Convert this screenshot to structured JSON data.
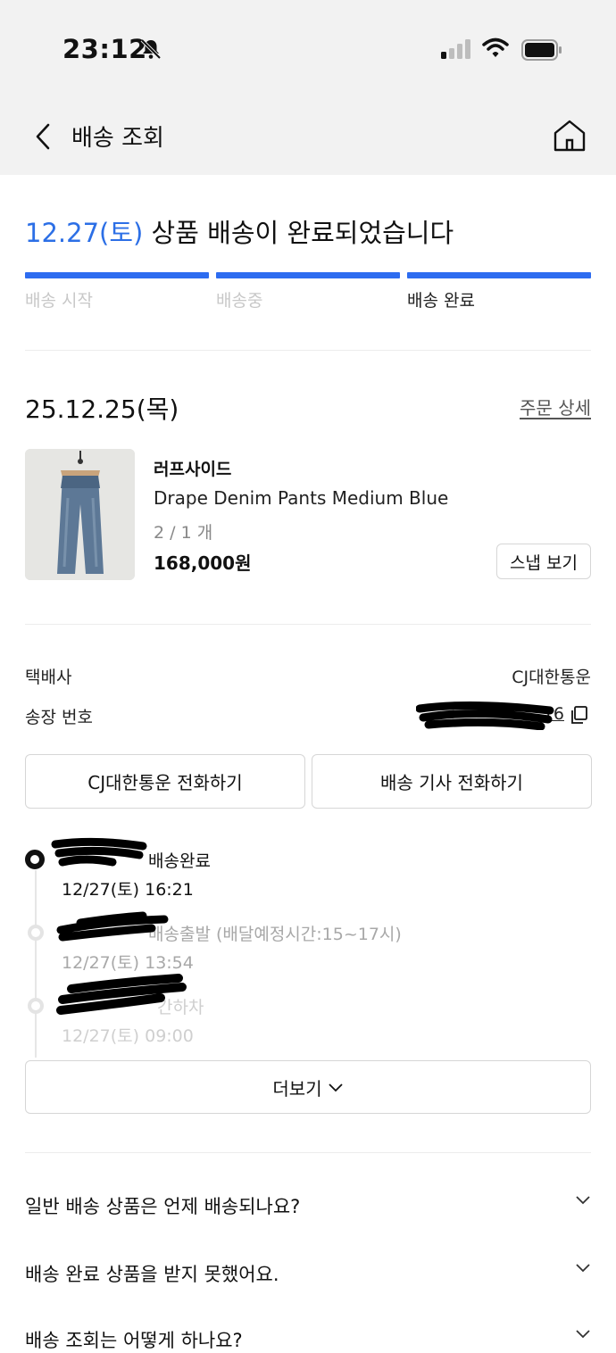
{
  "status_bar": {
    "time": "23:12"
  },
  "header": {
    "title": "배송 조회"
  },
  "headline": {
    "date": "12.27(토)",
    "text": " 상품 배송이 완료되었습니다"
  },
  "progress": {
    "steps": [
      {
        "label": "배송 시작"
      },
      {
        "label": "배송중"
      },
      {
        "label": "배송 완료"
      }
    ],
    "current_step_index": 2
  },
  "order": {
    "date": "25.12.25(목)",
    "detail_link": "주문 상세",
    "item": {
      "brand": "러프사이드",
      "name": "Drape Denim Pants Medium Blue",
      "option": "2 / 1 개",
      "price": "168,000원",
      "snap_button": "스냅 보기"
    }
  },
  "shipping": {
    "carrier_label": "택배사",
    "carrier_value": "CJ대한통운",
    "tracking_label": "송장 번호",
    "tracking_visible_suffix": "16",
    "call_carrier_button": "CJ대한통운 전화하기",
    "call_driver_button": "배송 기사 전화하기"
  },
  "timeline": [
    {
      "status": "배송완료",
      "time": "12/27(토) 16:21"
    },
    {
      "status": "배송출발 (배달예정시간:15~17시)",
      "time": "12/27(토) 13:54"
    },
    {
      "status": "간하차",
      "time": "12/27(토) 09:00"
    }
  ],
  "more_button": "더보기",
  "faq": [
    {
      "question": "일반 배송 상품은 언제 배송되나요?"
    },
    {
      "question": "배송 완료 상품을 받지 못했어요."
    },
    {
      "question": "배송 조회는 어떻게 하나요?"
    }
  ],
  "colors": {
    "accent": "#2d6cf0",
    "muted": "#c8c8c8"
  }
}
